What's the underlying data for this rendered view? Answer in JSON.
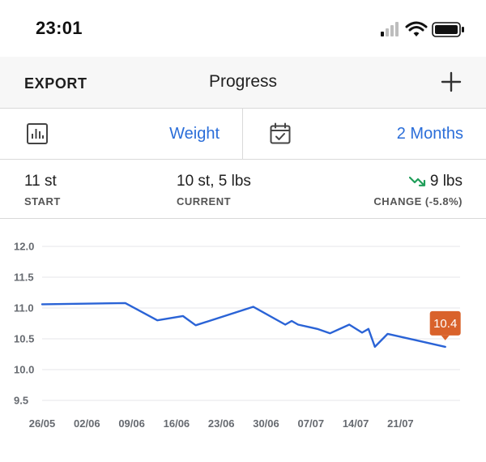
{
  "status": {
    "time": "23:01",
    "icons": [
      "signal-icon",
      "wifi-icon",
      "battery-icon"
    ]
  },
  "nav": {
    "export_label": "EXPORT",
    "title": "Progress",
    "add_icon": "plus-icon"
  },
  "selectors": {
    "metric_icon": "bar-chart-icon",
    "metric_value": "Weight",
    "range_icon": "calendar-check-icon",
    "range_value": "2 Months"
  },
  "summary": {
    "start": {
      "value": "11 st",
      "label": "START"
    },
    "current": {
      "value": "10 st, 5 lbs",
      "label": "CURRENT"
    },
    "change": {
      "value": "9 lbs",
      "label": "CHANGE (-5.8%)",
      "icon": "trend-down-icon"
    }
  },
  "colors": {
    "accent": "#2b6ed9",
    "line": "#2a63d6",
    "callout": "#d9622b",
    "trend_down": "#1f9e59",
    "grid": "#e4e6ea"
  },
  "chart_data": {
    "type": "line",
    "yticks": [
      "12.0",
      "11.5",
      "11.0",
      "10.5",
      "10.0",
      "9.5"
    ],
    "ylim": [
      9.5,
      12.0
    ],
    "xticks": [
      "26/05",
      "02/06",
      "09/06",
      "16/06",
      "23/06",
      "30/06",
      "07/07",
      "14/07",
      "21/07"
    ],
    "xstart": "2024-05-26",
    "series": [
      {
        "points": [
          [
            "26/05",
            11.06
          ],
          [
            "08/06",
            11.08
          ],
          [
            "13/06",
            10.8
          ],
          [
            "17/06",
            10.87
          ],
          [
            "19/06",
            10.72
          ],
          [
            "28/06",
            11.02
          ],
          [
            "03/07",
            10.73
          ],
          [
            "04/07",
            10.79
          ],
          [
            "05/07",
            10.73
          ],
          [
            "08/07",
            10.66
          ],
          [
            "10/07",
            10.59
          ],
          [
            "13/07",
            10.73
          ],
          [
            "15/07",
            10.6
          ],
          [
            "16/07",
            10.66
          ],
          [
            "17/07",
            10.37
          ],
          [
            "19/07",
            10.58
          ],
          [
            "28/07",
            10.37
          ]
        ]
      }
    ],
    "callout": {
      "label": "10.4"
    }
  }
}
